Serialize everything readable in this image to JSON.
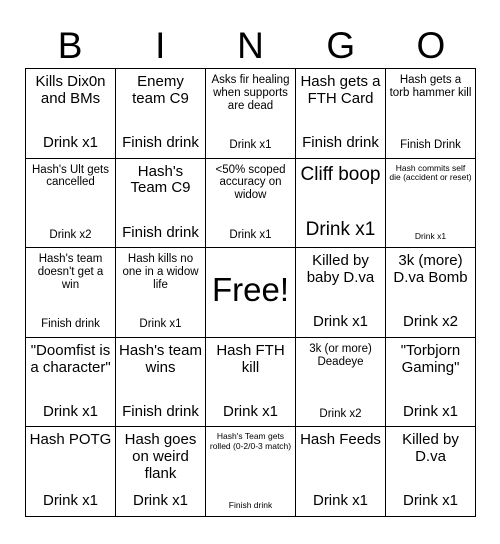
{
  "header": {
    "letters": [
      "B",
      "I",
      "N",
      "G",
      "O"
    ]
  },
  "grid": {
    "rows": 5,
    "columns": 5,
    "cells": [
      {
        "main": "Kills Dix0n and BMs",
        "sub": "Drink x1",
        "size": "md"
      },
      {
        "main": "Enemy team C9",
        "sub": "Finish drink",
        "size": "md"
      },
      {
        "main": "Asks fir healing when supports are dead",
        "sub": "Drink x1",
        "size": "sm"
      },
      {
        "main": "Hash gets a FTH Card",
        "sub": "Finish drink",
        "size": "md"
      },
      {
        "main": "Hash gets a torb hammer kill",
        "sub": "Finish Drink",
        "size": "sm"
      },
      {
        "main": "Hash's Ult gets cancelled",
        "sub": "Drink x2",
        "size": "sm"
      },
      {
        "main": "Hash's Team C9",
        "sub": "Finish drink",
        "size": "md"
      },
      {
        "main": "<50% scoped accuracy on widow",
        "sub": "Drink x1",
        "size": "sm"
      },
      {
        "main": "Cliff boop",
        "sub": "Drink x1",
        "size": "lg"
      },
      {
        "main": "Hash commits self die (accident or reset)",
        "sub": "Drink x1",
        "size": "xs"
      },
      {
        "main": "Hash's team doesn't get a win",
        "sub": "Finish drink",
        "size": "sm"
      },
      {
        "main": "Hash kills no one in a widow life",
        "sub": "Drink x1",
        "size": "sm"
      },
      {
        "main": "Free!",
        "sub": "",
        "size": "free"
      },
      {
        "main": "Killed by baby D.va",
        "sub": "Drink x1",
        "size": "md"
      },
      {
        "main": "3k (more) D.va Bomb",
        "sub": "Drink x2",
        "size": "md"
      },
      {
        "main": "\"Doomfist is a character\"",
        "sub": "Drink x1",
        "size": "md"
      },
      {
        "main": "Hash's team wins",
        "sub": "Finish drink",
        "size": "md"
      },
      {
        "main": "Hash FTH kill",
        "sub": "Drink x1",
        "size": "md"
      },
      {
        "main": "3k (or more) Deadeye",
        "sub": "Drink x2",
        "size": "sm"
      },
      {
        "main": "\"Torbjorn Gaming\"",
        "sub": "Drink x1",
        "size": "md"
      },
      {
        "main": "Hash POTG",
        "sub": "Drink x1",
        "size": "md"
      },
      {
        "main": "Hash goes on weird flank",
        "sub": "Drink x1",
        "size": "md"
      },
      {
        "main": "Hash's Team gets rolled (0-2/0-3 match)",
        "sub": "Finish drink",
        "size": "xs"
      },
      {
        "main": "Hash Feeds",
        "sub": "Drink x1",
        "size": "md"
      },
      {
        "main": "Killed by D.va",
        "sub": "Drink x1",
        "size": "md"
      }
    ]
  },
  "colors": {
    "background": "#ffffff",
    "text": "#000000",
    "border": "#000000"
  }
}
